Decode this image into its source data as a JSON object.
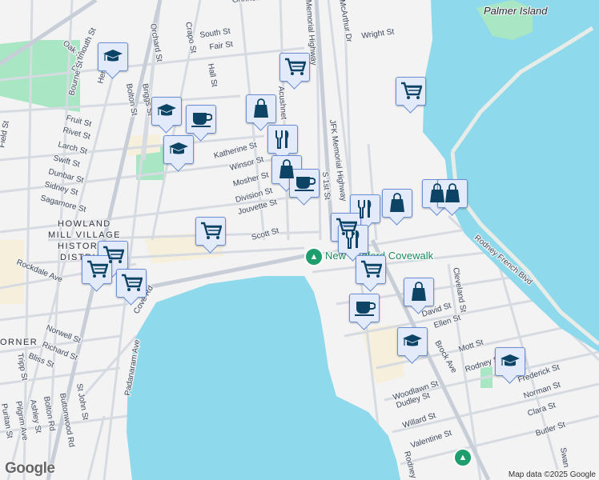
{
  "map": {
    "water_color": "#8ed9ec",
    "land_color": "#f4f3f3",
    "park_color": "#a8e6c4",
    "marker_color": "#0d4466",
    "areas": [
      "HOWLAND",
      "MILL VILLAGE",
      "HISTORIC",
      "DISTRICT",
      "ORNER"
    ],
    "island": "Palmer Island",
    "poi": "New Bedford Covewalk",
    "streets": [
      "Oak St",
      "Dartmouth St",
      "Orchard St",
      "Crapo St",
      "South St",
      "Fair St",
      "Hall St",
      "Bolton St",
      "Briggs St",
      "Hemlock St",
      "Bourne St",
      "Fruit St",
      "Rivet St",
      "Larch St",
      "Swift St",
      "Dunbar St",
      "Sidney St",
      "Sagamore St",
      "Field St",
      "Katherine St",
      "Winsor St",
      "Mosher St",
      "Division St",
      "Jouvette St",
      "Scott St",
      "Rockdale Ave",
      "Cove Rd",
      "Norwell St",
      "Richard St",
      "Bliss St",
      "Tripp St",
      "Puritan St",
      "Pilgrim Ave",
      "Ashley St",
      "Bolton Rd",
      "Buttonwood Rd",
      "St John St",
      "Padanaram Ave",
      "Memorial Highway",
      "JFK Memorial Highway",
      "S 1st St",
      "Wright St",
      "Acushnet",
      "Rodney French Blvd",
      "Cleveland St",
      "David St",
      "Ellen St",
      "Brock Ave",
      "Mott St",
      "Rodney St",
      "Woodlawn St",
      "Dudley St",
      "Willard St",
      "Valentine St",
      "Frederick St",
      "Norman St",
      "Clara St",
      "Butler St",
      "Swan",
      "Rodney",
      "Grinnell St",
      "McArthur Dr"
    ],
    "markers": [
      "education",
      "cafe",
      "education",
      "education",
      "grocery",
      "shopping",
      "restaurant",
      "shopping",
      "cafe",
      "grocery",
      "shopping",
      "shopping",
      "restaurant",
      "shopping",
      "grocery",
      "grocery",
      "restaurant",
      "grocery",
      "grocery",
      "grocery",
      "grocery",
      "shopping",
      "cafe",
      "education",
      "education"
    ]
  },
  "footer": {
    "logo": "Google",
    "attribution": "Map data ©2025 Google"
  }
}
